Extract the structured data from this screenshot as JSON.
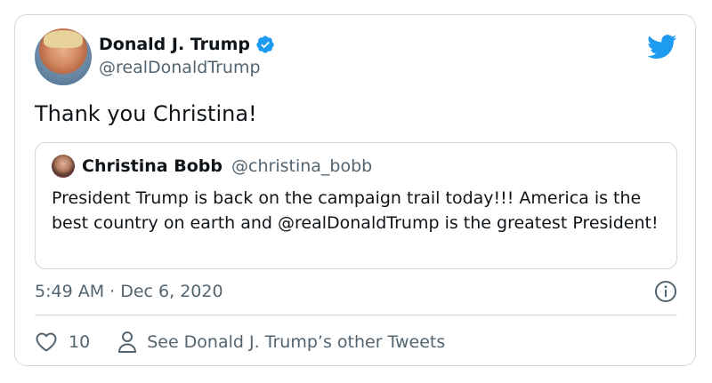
{
  "author": {
    "display_name": "Donald J. Trump",
    "handle": "@realDonaldTrump",
    "verified": true
  },
  "tweet": {
    "text": "Thank you Christina!",
    "timestamp": "5:49 AM · Dec 6, 2020"
  },
  "quoted": {
    "display_name": "Christina Bobb",
    "handle": "@christina_bobb",
    "text": "President Trump is back on the campaign trail today!!!  America is the best country on earth and @realDonaldTrump is the greatest President!"
  },
  "actions": {
    "like_count": "10",
    "other_tweets_label": "See Donald J. Trump’s other Tweets"
  },
  "icons": {
    "brand": "twitter-bird-icon",
    "verified": "verified-badge-icon",
    "info": "info-icon",
    "like": "heart-icon",
    "profile": "person-icon"
  },
  "colors": {
    "twitter_blue": "#1d9bf0",
    "secondary_text": "#536471",
    "border": "#cfd9de"
  }
}
